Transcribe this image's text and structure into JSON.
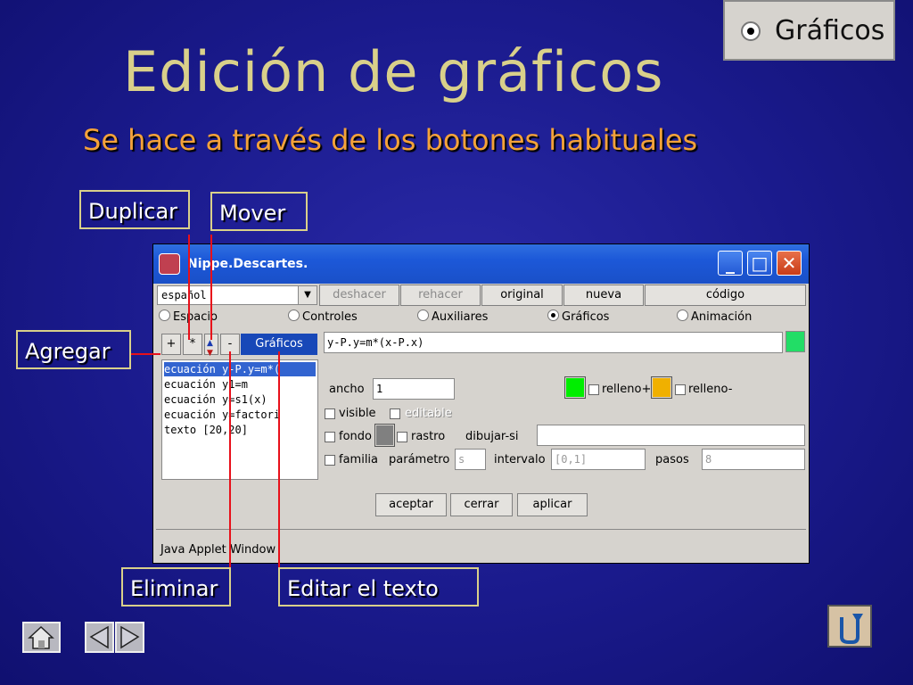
{
  "slide": {
    "title": "Edición de gráficos",
    "subtitle": "Se hace a través de los botones habituales"
  },
  "thumbnail": {
    "label": "Gráficos"
  },
  "callouts": {
    "duplicar": "Duplicar",
    "mover": "Mover",
    "agregar": "Agregar",
    "eliminar": "Eliminar",
    "editar": "Editar el texto"
  },
  "window": {
    "title": "Nippe.Descartes.",
    "language": "español",
    "toolbar": [
      "deshacer",
      "rehacer",
      "original",
      "nueva",
      "código"
    ],
    "tabs": [
      {
        "label": "Espacio",
        "selected": false
      },
      {
        "label": "Controles",
        "selected": false
      },
      {
        "label": "Auxiliares",
        "selected": false
      },
      {
        "label": "Gráficos",
        "selected": true
      },
      {
        "label": "Animación",
        "selected": false
      }
    ],
    "small_buttons": {
      "add": "+",
      "dup": "*",
      "del": "-"
    },
    "list_header": "Gráficos",
    "expression": "y-P.y=m*(x-P.x)",
    "list_items": [
      "ecuación y-P.y=m*(",
      "ecuación y1=m",
      "ecuación y=s1(x)",
      "ecuación y=factori",
      "texto [20,20]"
    ],
    "props": {
      "ancho_label": "ancho",
      "ancho_value": "1",
      "relleno_plus": "relleno+",
      "relleno_minus": "relleno-",
      "visible": "visible",
      "editable": "editable",
      "fondo": "fondo",
      "rastro": "rastro",
      "dibujar_si": "dibujar-si",
      "familia": "familia",
      "parametro_label": "parámetro",
      "parametro_value": "s",
      "intervalo_label": "intervalo",
      "intervalo_value": "[0,1]",
      "pasos_label": "pasos",
      "pasos_value": "8"
    },
    "bottom_buttons": [
      "aceptar",
      "cerrar",
      "aplicar"
    ],
    "status": "Java Applet Window"
  },
  "colors": {
    "relleno_plus": "#00ee00",
    "relleno_minus": "#f0b000",
    "fondo": "#808080",
    "expression_color": "#22dd66"
  }
}
